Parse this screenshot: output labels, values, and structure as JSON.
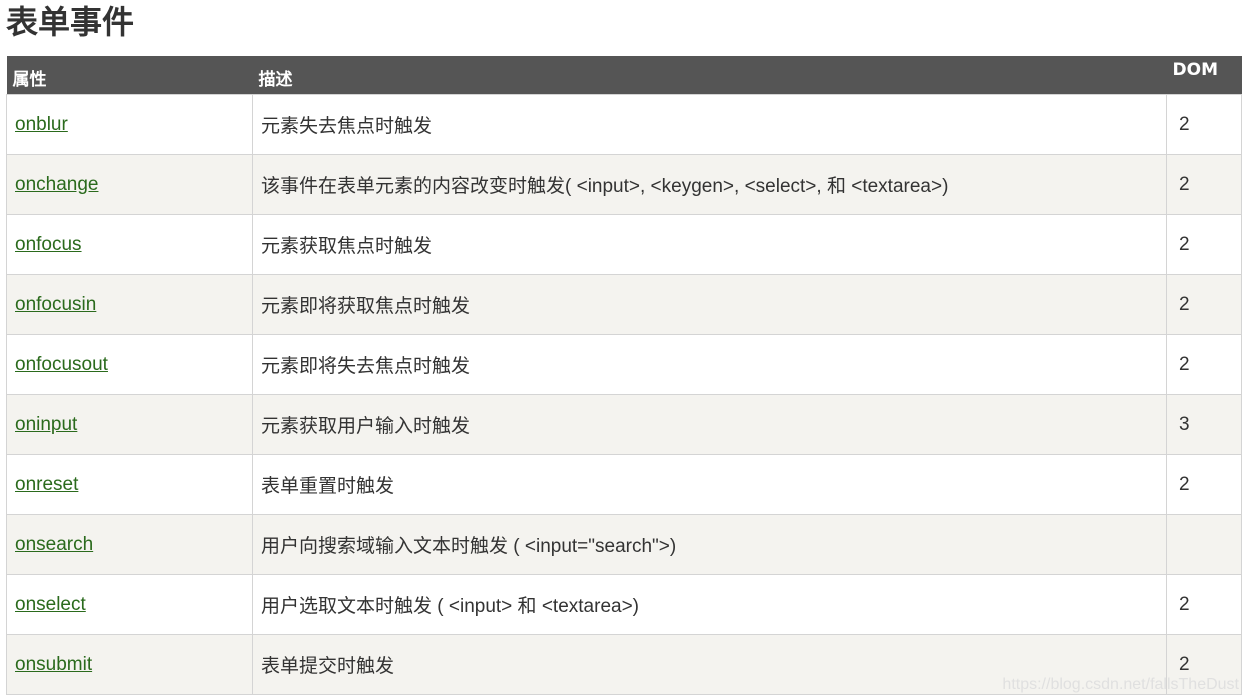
{
  "page": {
    "title": "表单事件"
  },
  "table": {
    "headers": {
      "attribute": "属性",
      "description": "描述",
      "dom": "DOM"
    },
    "rows": [
      {
        "attribute": "onblur",
        "description": "元素失去焦点时触发",
        "dom": "2"
      },
      {
        "attribute": "onchange",
        "description": "该事件在表单元素的内容改变时触发( <input>, <keygen>, <select>, 和 <textarea>)",
        "dom": "2"
      },
      {
        "attribute": "onfocus",
        "description": "元素获取焦点时触发",
        "dom": "2"
      },
      {
        "attribute": "onfocusin",
        "description": "元素即将获取焦点时触发",
        "dom": "2"
      },
      {
        "attribute": "onfocusout",
        "description": "元素即将失去焦点时触发",
        "dom": "2"
      },
      {
        "attribute": "oninput",
        "description": "元素获取用户输入时触发",
        "dom": "3"
      },
      {
        "attribute": "onreset",
        "description": "表单重置时触发",
        "dom": "2"
      },
      {
        "attribute": "onsearch",
        "description": "用户向搜索域输入文本时触发 ( <input=\"search\">)",
        "dom": ""
      },
      {
        "attribute": "onselect",
        "description": "用户选取文本时触发 ( <input> 和 <textarea>)",
        "dom": "2"
      },
      {
        "attribute": "onsubmit",
        "description": "表单提交时触发",
        "dom": "2"
      }
    ]
  },
  "watermark": "https://blog.csdn.net/fallsTheDust",
  "colors": {
    "header_bg": "#555555",
    "alt_row_bg": "#f4f3ef",
    "link": "#2a6a1c"
  }
}
